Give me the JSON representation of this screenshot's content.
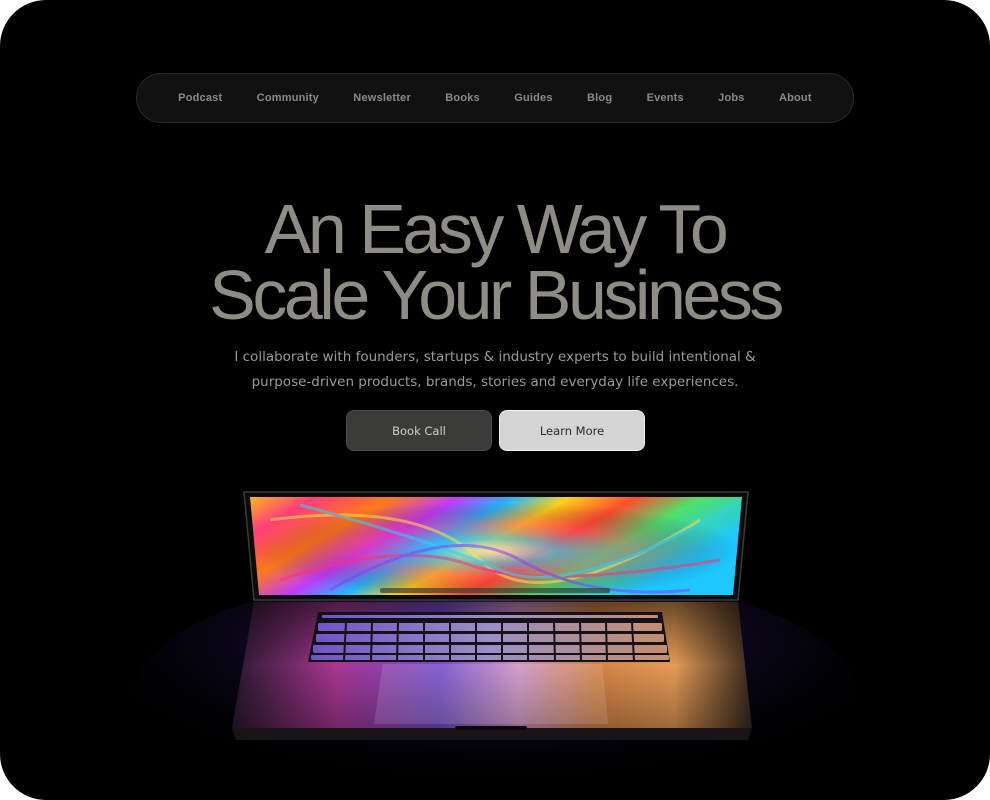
{
  "nav": {
    "items": [
      {
        "label": "Podcast"
      },
      {
        "label": "Community"
      },
      {
        "label": "Newsletter"
      },
      {
        "label": "Books"
      },
      {
        "label": "Guides"
      },
      {
        "label": "Blog"
      },
      {
        "label": "Events"
      },
      {
        "label": "Jobs"
      },
      {
        "label": "About"
      }
    ]
  },
  "hero": {
    "headline_line1": "An Easy Way To",
    "headline_line2": "Scale Your Business",
    "subtext_line1": "I collaborate with founders, startups & industry experts to build intentional &",
    "subtext_line2": "purpose-driven products, brands, stories and everyday life experiences.",
    "primary_button": "Book Call",
    "secondary_button": "Learn More"
  },
  "colors": {
    "background": "#000000",
    "headline": "#8e8c84",
    "nav_text": "#8a8a84"
  },
  "image": {
    "subject": "laptop-icon"
  }
}
